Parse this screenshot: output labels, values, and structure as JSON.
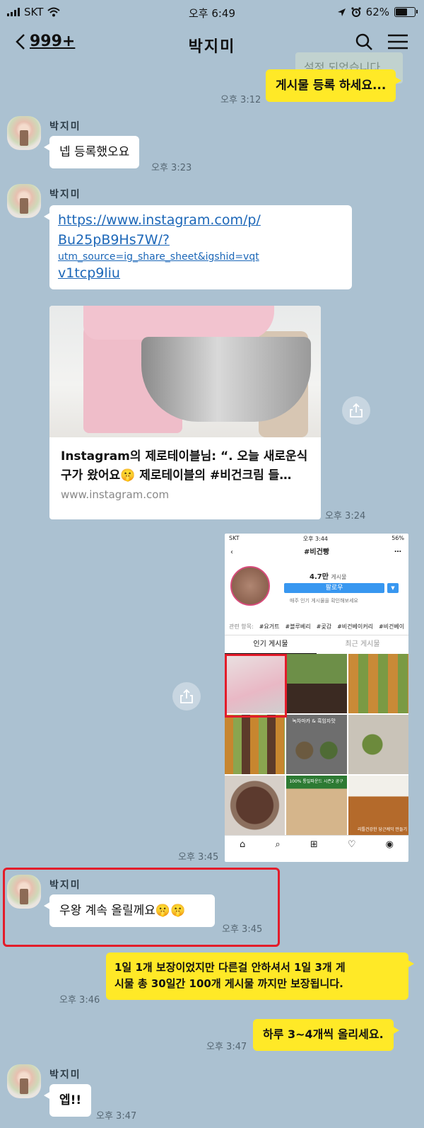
{
  "status_bar": {
    "carrier": "SKT",
    "time": "오후 6:49",
    "battery": "62%",
    "battery_level": 0.62
  },
  "header": {
    "back_count": "999+",
    "title": "박지미",
    "toast": "설정 되었습니다",
    "icons": [
      "chevron-left-icon",
      "search-icon",
      "menu-icon"
    ]
  },
  "messages": {
    "m1": {
      "text": "게시물 등록 하세요...",
      "time": "오후 3:12"
    },
    "m2": {
      "name": "박지미",
      "text": "넵 등록했오요",
      "time": "오후 3:23"
    },
    "m3": {
      "name": "박지미",
      "link_lines": [
        "https://www.instagram.com/p/",
        "Bu25pB9Hs7W/?",
        "utm_source=ig_share_sheet&igshid=vqt",
        "v1tcp9liu"
      ],
      "card_title": "Instagram의 제로테이블님: “. 오늘 새로운식구가 왔어요🤫 제로테이블의 #비건크림 들…",
      "card_domain": "www.instagram.com",
      "time": "오후 3:24"
    },
    "m4": {
      "time": "오후 3:45",
      "insta": {
        "carrier": "SKT",
        "time": "오후 3:44",
        "battery": "56%",
        "hashtag": "#비건빵",
        "count": "4.7만",
        "count_label": "게시물",
        "follow": "팔로우",
        "note": "매주 인기 게시물을 확인해보세요",
        "related_label": "관련 항목:",
        "related": [
          "#요거트",
          "#블루베리",
          "#곶감",
          "#비건베이커리",
          "#비건베이"
        ],
        "tabs": [
          "인기 게시물",
          "최근 게시물"
        ],
        "tile_texts": {
          "t5": "녹차마카 & 흑임자맛",
          "t8": "100% 통밀파운드 시즌2 공구",
          "t9": "리틀건강한 당근케익 만들기"
        },
        "nav_icons": [
          "home-icon",
          "search-icon",
          "plus-icon",
          "heart-icon",
          "profile-icon"
        ]
      }
    },
    "m5": {
      "name": "박지미",
      "text": "우왕 계속 올릴께요🤫🤫",
      "time": "오후 3:45"
    },
    "m6": {
      "line1": "1일 1개 보장이었지만 다른걸 안하셔서 1일 3개 게",
      "line2": "시물 총 30일간 100개 게시물 까지만 보장됩니다.",
      "time": "오후 3:46"
    },
    "m7": {
      "text": "하루 3~4개씩 올리세요.",
      "time": "오후 3:47"
    },
    "m8": {
      "name": "박지미",
      "text": "엡!!",
      "time": "오후 3:47"
    }
  },
  "colors": {
    "chat_bg": "#abc1d1",
    "my_bubble": "#ffe927",
    "other_bubble": "#ffffff",
    "highlight": "#e31c2a",
    "link": "#1c67b8"
  }
}
